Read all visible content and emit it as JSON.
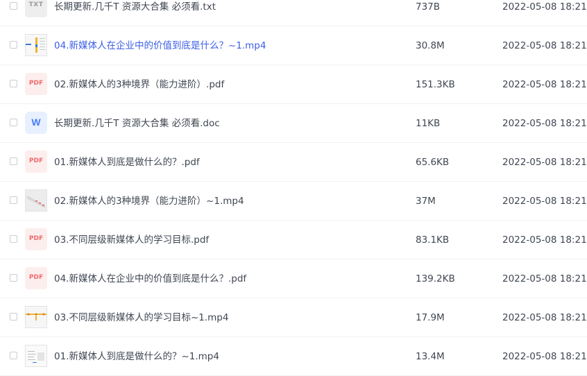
{
  "files": [
    {
      "icon": "txt-icon",
      "icon_text": "TXT",
      "name": "长期更新.几千T 资源大合集 必须看.txt",
      "size": "737B",
      "date": "2022-05-08 18:21"
    },
    {
      "icon": "video-thumbnail-icon",
      "icon_text": "",
      "name": "04.新媒体人在企业中的价值到底是什么？~1.mp4",
      "size": "30.8M",
      "date": "2022-05-08 18:21"
    },
    {
      "icon": "pdf-icon",
      "icon_text": "PDF",
      "name": "02.新媒体人的3种境界（能力进阶）.pdf",
      "size": "151.3KB",
      "date": "2022-05-08 18:21"
    },
    {
      "icon": "word-icon",
      "icon_text": "W",
      "name": "长期更新.几千T 资源大合集 必须看.doc",
      "size": "11KB",
      "date": "2022-05-08 18:21"
    },
    {
      "icon": "pdf-icon",
      "icon_text": "PDF",
      "name": "01.新媒体人到底是做什么的？.pdf",
      "size": "65.6KB",
      "date": "2022-05-08 18:21"
    },
    {
      "icon": "video-thumbnail-icon",
      "icon_text": "",
      "name": "02.新媒体人的3种境界（能力进阶）~1.mp4",
      "size": "37M",
      "date": "2022-05-08 18:21"
    },
    {
      "icon": "pdf-icon",
      "icon_text": "PDF",
      "name": "03.不同层级新媒体人的学习目标.pdf",
      "size": "83.1KB",
      "date": "2022-05-08 18:21"
    },
    {
      "icon": "pdf-icon",
      "icon_text": "PDF",
      "name": "04.新媒体人在企业中的价值到底是什么？.pdf",
      "size": "139.2KB",
      "date": "2022-05-08 18:21"
    },
    {
      "icon": "video-thumbnail-icon",
      "icon_text": "",
      "name": "03.不同层级新媒体人的学习目标~1.mp4",
      "size": "17.9M",
      "date": "2022-05-08 18:21"
    },
    {
      "icon": "video-thumbnail-icon",
      "icon_text": "",
      "name": "01.新媒体人到底是做什么的？~1.mp4",
      "size": "13.4M",
      "date": "2022-05-08 18:21"
    }
  ],
  "colors": {
    "link_text": "#3b5ee6",
    "text": "#3f4652",
    "pdf_accent": "#f06a6a",
    "word_accent": "#4a7cf7"
  }
}
